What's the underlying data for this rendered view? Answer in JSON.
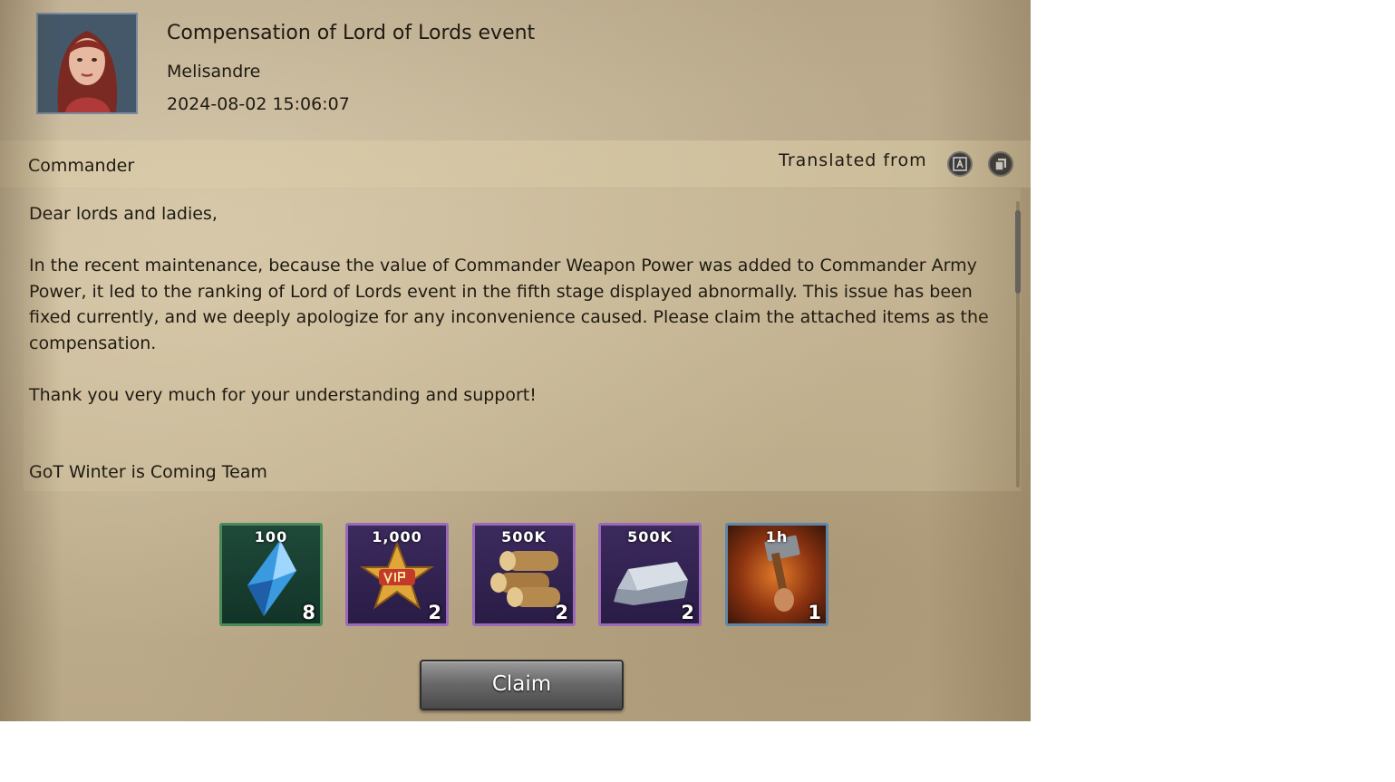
{
  "mail": {
    "title": "Compensation of Lord of Lords event",
    "sender": "Melisandre",
    "timestamp": "2024-08-02 15:06:07",
    "greeting_name": "Commander",
    "translated_label": "Translated from",
    "paragraphs": [
      "Dear lords and ladies,",
      "In the recent maintenance, because the value of Commander Weapon Power was added to Commander Army Power, it led to the ranking of Lord of Lords event in the fifth stage displayed abnormally. This issue has been fixed currently, and we deeply apologize for any inconvenience caused. Please claim the attached items as the compensation.",
      "Thank you very much for your understanding and support!",
      "GoT Winter is Coming Team"
    ]
  },
  "rewards": [
    {
      "icon": "blue-crystal-icon",
      "amount": "100",
      "qty": "8",
      "frame": "#4a8a5a"
    },
    {
      "icon": "vip-star-icon",
      "amount": "1,000",
      "qty": "2",
      "frame": "#9a6ab8"
    },
    {
      "icon": "wood-logs-icon",
      "amount": "500K",
      "qty": "2",
      "frame": "#9a6ab8"
    },
    {
      "icon": "iron-ingot-icon",
      "amount": "500K",
      "qty": "2",
      "frame": "#9a6ab8"
    },
    {
      "icon": "hammer-speedup-icon",
      "amount": "1h",
      "qty": "1",
      "frame": "#5f86a8"
    }
  ],
  "claim_label": "Claim"
}
